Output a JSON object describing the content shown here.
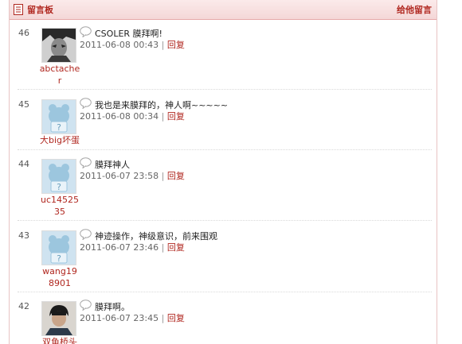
{
  "header": {
    "title": "留言板",
    "action": "给他留言"
  },
  "reply_label": "回复",
  "entries": [
    {
      "num": "46",
      "user_lines": [
        "abctache",
        "r"
      ],
      "message": "CSOLER  膜拜啊!",
      "time": "2011-06-08 00:43",
      "avatar": "photo-dark"
    },
    {
      "num": "45",
      "user_lines": [
        "大big坏蛋"
      ],
      "message": "我也是来膜拜的，神人啊~~~~~",
      "time": "2011-06-08 00:34",
      "avatar": "default-bear"
    },
    {
      "num": "44",
      "user_lines": [
        "uc14525",
        "35"
      ],
      "message": "膜拜神人",
      "time": "2011-06-07 23:58",
      "avatar": "default-bear"
    },
    {
      "num": "43",
      "user_lines": [
        "wang19",
        "8901"
      ],
      "message": "神迹操作，神级意识，前来围观",
      "time": "2011-06-07 23:46",
      "avatar": "default-bear"
    },
    {
      "num": "42",
      "user_lines": [
        "双鱼桥头"
      ],
      "message": "膜拜啊。",
      "time": "2011-06-07 23:45",
      "avatar": "photo-person"
    }
  ]
}
